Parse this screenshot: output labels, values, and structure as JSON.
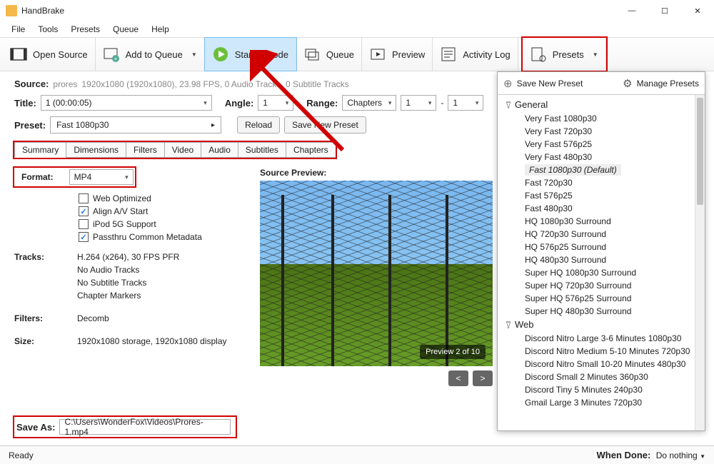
{
  "window": {
    "title": "HandBrake"
  },
  "menubar": {
    "file": "File",
    "tools": "Tools",
    "presets": "Presets",
    "queue": "Queue",
    "help": "Help"
  },
  "toolbar": {
    "open_source": "Open Source",
    "add_to_queue": "Add to Queue",
    "start_encode": "Start Encode",
    "queue": "Queue",
    "preview": "Preview",
    "activity_log": "Activity Log",
    "presets": "Presets"
  },
  "source": {
    "label": "Source:",
    "name": "prores",
    "details": "1920x1080 (1920x1080), 23.98 FPS, 0 Audio Tracks, 0 Subtitle Tracks"
  },
  "title_row": {
    "title_label": "Title:",
    "title_value": "1 (00:00:05)",
    "angle_label": "Angle:",
    "angle_value": "1",
    "range_label": "Range:",
    "range_type": "Chapters",
    "range_from": "1",
    "range_sep": "-",
    "range_to": "1"
  },
  "preset_row": {
    "label": "Preset:",
    "value": "Fast 1080p30",
    "reload": "Reload",
    "save_new": "Save New Preset"
  },
  "tabs": {
    "summary": "Summary",
    "dimensions": "Dimensions",
    "filters": "Filters",
    "video": "Video",
    "audio": "Audio",
    "subtitles": "Subtitles",
    "chapters": "Chapters"
  },
  "format": {
    "label": "Format:",
    "value": "MP4"
  },
  "options": {
    "web_optimized": "Web Optimized",
    "align_av": "Align A/V Start",
    "ipod": "iPod 5G Support",
    "passthru": "Passthru Common Metadata"
  },
  "tracks": {
    "label": "Tracks:",
    "video": "H.264 (x264), 30 FPS PFR",
    "audio": "No Audio Tracks",
    "subtitle": "No Subtitle Tracks",
    "chapters": "Chapter Markers"
  },
  "filters": {
    "label": "Filters:",
    "value": "Decomb"
  },
  "size": {
    "label": "Size:",
    "value": "1920x1080 storage, 1920x1080 display"
  },
  "preview": {
    "label": "Source Preview:",
    "counter": "Preview 2 of 10",
    "prev": "<",
    "next": ">"
  },
  "saveas": {
    "label": "Save As:",
    "value": "C:\\Users\\WonderFox\\Videos\\Prores-1.mp4"
  },
  "statusbar": {
    "ready": "Ready",
    "when_done_label": "When Done:",
    "when_done_value": "Do nothing"
  },
  "presets_panel": {
    "save_new": "Save New Preset",
    "manage": "Manage Presets",
    "group_general": "General",
    "default_suffix": "(Default)",
    "general": [
      "Very Fast 1080p30",
      "Very Fast 720p30",
      "Very Fast 576p25",
      "Very Fast 480p30",
      "Fast 1080p30",
      "Fast 720p30",
      "Fast 576p25",
      "Fast 480p30",
      "HQ 1080p30 Surround",
      "HQ 720p30 Surround",
      "HQ 576p25 Surround",
      "HQ 480p30 Surround",
      "Super HQ 1080p30 Surround",
      "Super HQ 720p30 Surround",
      "Super HQ 576p25 Surround",
      "Super HQ 480p30 Surround"
    ],
    "group_web": "Web",
    "web": [
      "Discord Nitro Large 3-6 Minutes 1080p30",
      "Discord Nitro Medium 5-10 Minutes 720p30",
      "Discord Nitro Small 10-20 Minutes 480p30",
      "Discord Small 2 Minutes 360p30",
      "Discord Tiny 5 Minutes 240p30",
      "Gmail Large 3 Minutes 720p30"
    ]
  }
}
